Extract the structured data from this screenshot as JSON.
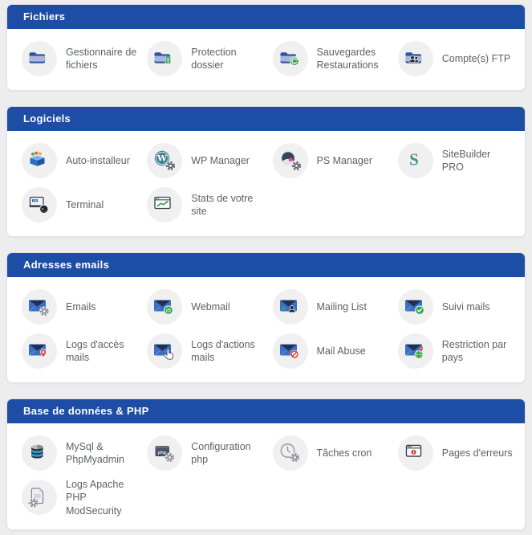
{
  "colors": {
    "page_bg": "#ededee",
    "header_bg": "#1e4da5",
    "header_text": "#ffffff",
    "card_bg": "#ffffff",
    "icon_circle_bg": "#f0f0f1",
    "label_text": "#5d6167",
    "folder_blue": "#2c55a5",
    "envelope_blue": "#3a6fc4",
    "badge_green": "#2fa44c",
    "badge_red": "#d8453e"
  },
  "sections": [
    {
      "title": "Fichiers",
      "items": [
        {
          "label": "Gestionnaire de fichiers",
          "icon": "folder"
        },
        {
          "label": "Protection dossier",
          "icon": "folder-lock"
        },
        {
          "label": "Sauvegardes Restaurations",
          "icon": "folder-restore"
        },
        {
          "label": "Compte(s) FTP",
          "icon": "folder-users"
        }
      ]
    },
    {
      "title": "Logiciels",
      "items": [
        {
          "label": "Auto-installeur",
          "icon": "installer-box"
        },
        {
          "label": "WP Manager",
          "icon": "wordpress"
        },
        {
          "label": "PS Manager",
          "icon": "prestashop"
        },
        {
          "label": "SiteBuilder PRO",
          "icon": "sitebuilder"
        },
        {
          "label": "Terminal",
          "icon": "terminal"
        },
        {
          "label": "Stats de votre site",
          "icon": "site-stats"
        }
      ]
    },
    {
      "title": "Adresses emails",
      "items": [
        {
          "label": "Emails",
          "icon": "mail-gear"
        },
        {
          "label": "Webmail",
          "icon": "mail-at"
        },
        {
          "label": "Mailing List",
          "icon": "mail-list"
        },
        {
          "label": "Suivi mails",
          "icon": "mail-check"
        },
        {
          "label": "Logs d'accès mails",
          "icon": "mail-pin"
        },
        {
          "label": "Logs d'actions mails",
          "icon": "mail-hand"
        },
        {
          "label": "Mail Abuse",
          "icon": "mail-block"
        },
        {
          "label": "Restriction par pays",
          "icon": "mail-globe"
        }
      ]
    },
    {
      "title": "Base de données & PHP",
      "items": [
        {
          "label": "MySql & PhpMyadmin",
          "icon": "database"
        },
        {
          "label": "Configuration php",
          "icon": "php-config"
        },
        {
          "label": "Tâches cron",
          "icon": "cron-clock"
        },
        {
          "label": "Pages d'erreurs",
          "icon": "error-page"
        },
        {
          "label": "Logs Apache PHP ModSecurity",
          "icon": "document-gear"
        }
      ]
    }
  ]
}
